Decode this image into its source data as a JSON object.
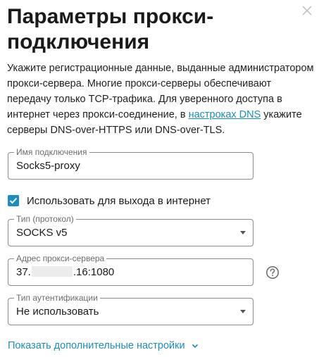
{
  "dialog": {
    "title": "Параметры прокси-подключения",
    "description": {
      "part1": "Укажите регистрационные данные, выданные администратором прокси-сервера. Многие прокси-серверы обеспечивают передачу только TCP-трафика. Для уверенного доступа в интернет через прокси-соединение, в ",
      "link": "настроках DNS",
      "part2": " укажите серверы DNS-over-HTTPS или DNS-over-TLS."
    },
    "connection_name": {
      "label": "Имя подключения",
      "value": "Socks5-proxy"
    },
    "use_for_internet": {
      "label": "Использовать для выхода в интернет",
      "checked": true
    },
    "protocol": {
      "label": "Тип (протокол)",
      "value": "SOCKS v5"
    },
    "proxy_address": {
      "label": "Адрес прокси-сервера",
      "value_prefix": "37.",
      "value_suffix": ".16:1080"
    },
    "auth_type": {
      "label": "Тип аутентификации",
      "value": "Не использовать"
    },
    "more_settings": "Показать дополнительные настройки"
  },
  "colors": {
    "accent": "#1a8dc1",
    "border": "#8c8c8c",
    "label": "#6b6b6b"
  }
}
